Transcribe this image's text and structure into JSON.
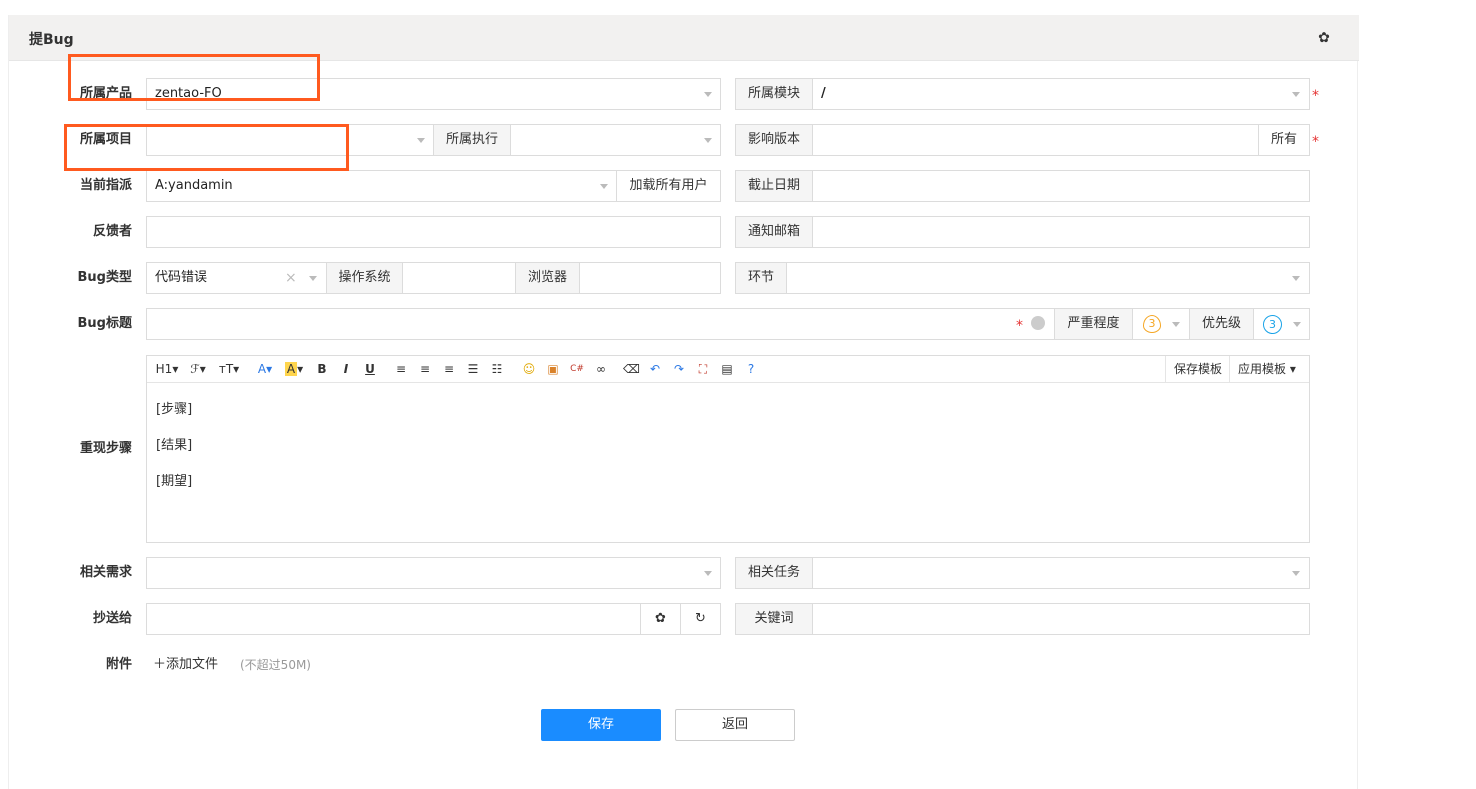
{
  "header": {
    "title": "提Bug"
  },
  "form": {
    "product": {
      "label": "所属产品",
      "value": "zentao-FO"
    },
    "module": {
      "label": "所属模块",
      "value": "/"
    },
    "project": {
      "label": "所属项目",
      "value": ""
    },
    "execution": {
      "label": "所属执行",
      "value": ""
    },
    "build": {
      "label": "影响版本",
      "value": "",
      "all_label": "所有"
    },
    "assigned": {
      "label": "当前指派",
      "value": "A:yandamin",
      "load_all": "加载所有用户"
    },
    "deadline": {
      "label": "截止日期",
      "value": ""
    },
    "feedback": {
      "label": "反馈者",
      "value": ""
    },
    "notify": {
      "label": "通知邮箱",
      "value": ""
    },
    "bug_type": {
      "label": "Bug类型",
      "value": "代码错误"
    },
    "os": {
      "label": "操作系统",
      "value": ""
    },
    "browser": {
      "label": "浏览器",
      "value": ""
    },
    "stage": {
      "label": "环节",
      "value": ""
    },
    "title": {
      "label": "Bug标题",
      "value": ""
    },
    "severity": {
      "label": "严重程度",
      "value": "3"
    },
    "priority": {
      "label": "优先级",
      "value": "3"
    },
    "steps": {
      "label": "重现步骤",
      "lines": [
        "[步骤]",
        "[结果]",
        "[期望]"
      ],
      "save_template": "保存模板",
      "apply_template": "应用模板"
    },
    "story": {
      "label": "相关需求",
      "value": ""
    },
    "task": {
      "label": "相关任务",
      "value": ""
    },
    "mailto": {
      "label": "抄送给",
      "value": ""
    },
    "keywords": {
      "label": "关键词",
      "value": ""
    },
    "attachments": {
      "label": "附件",
      "add_file": "添加文件",
      "limit": "(不超过50M)"
    }
  },
  "actions": {
    "save": "保存",
    "back": "返回"
  },
  "colors": {
    "primary": "#1a8cff",
    "highlight": "#ff5a1f",
    "required": "#e53333",
    "severity": "#f5a623",
    "priority": "#1aa3e8"
  }
}
